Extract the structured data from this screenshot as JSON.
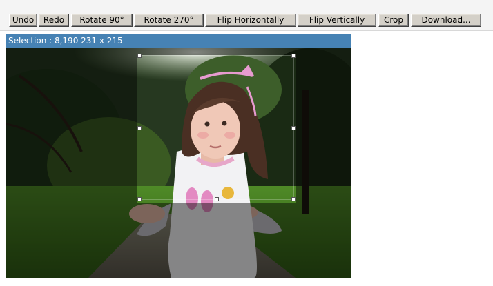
{
  "toolbar": {
    "undo": "Undo",
    "redo": "Redo",
    "rotate90": "Rotate 90°",
    "rotate270": "Rotate 270°",
    "flip_h": "Flip Horizontally",
    "flip_v": "Flip Vertically",
    "crop": "Crop",
    "download": "Download..."
  },
  "status": {
    "selection_text": "Selection : 8,190 231 x 215"
  },
  "colors": {
    "status_bar_bg": "#4682b4",
    "button_face": "#d4d0c8"
  }
}
